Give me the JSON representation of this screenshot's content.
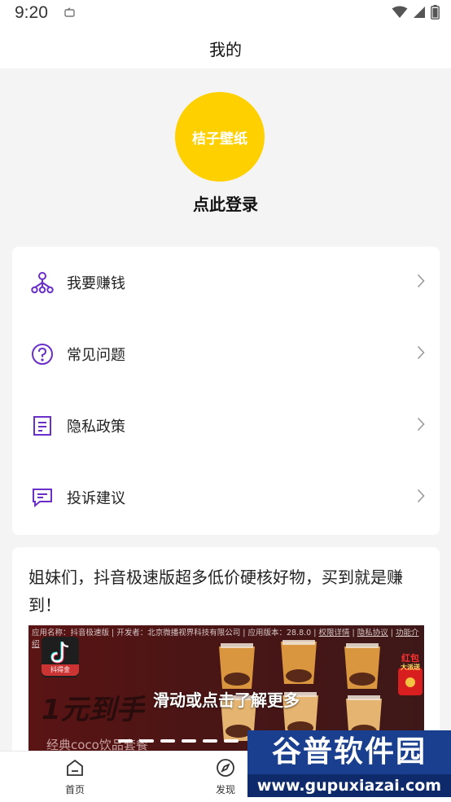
{
  "status_bar": {
    "time": "9:20"
  },
  "header": {
    "title": "我的"
  },
  "profile": {
    "avatar_text": "桔子壁纸",
    "login_label": "点此登录",
    "avatar_color": "#ffd000"
  },
  "menu": {
    "items": [
      {
        "label": "我要赚钱",
        "icon": "network-icon"
      },
      {
        "label": "常见问题",
        "icon": "question-circle-icon"
      },
      {
        "label": "隐私政策",
        "icon": "document-icon"
      },
      {
        "label": "投诉建议",
        "icon": "message-icon"
      }
    ],
    "accent_color": "#6a2fc9"
  },
  "ad": {
    "headline": "姐妹们，抖音极速版超多低价硬核好物，买到就是赚到！",
    "meta_prefix": "应用名称：抖音极速版 | 开发者：北京微播视界科技有限公司 | 应用版本：28.8.0 | ",
    "meta_link_permission": "权限详情",
    "meta_link_privacy": "隐私协议",
    "meta_link_function": "功能介绍",
    "logo_tag": "抖得金",
    "big_text": "1元到手",
    "cta": "滑动或点击了解更多",
    "subtitle": "经典coco饮品套餐",
    "redpack_text_1": "红包",
    "redpack_text_2": "大派送"
  },
  "bottom_nav": {
    "items": [
      {
        "label": "首页",
        "icon": "home-icon"
      },
      {
        "label": "发现",
        "icon": "compass-icon"
      }
    ]
  },
  "watermark": {
    "title": "谷普软件园",
    "url": "www.gupuxiazai.com"
  }
}
